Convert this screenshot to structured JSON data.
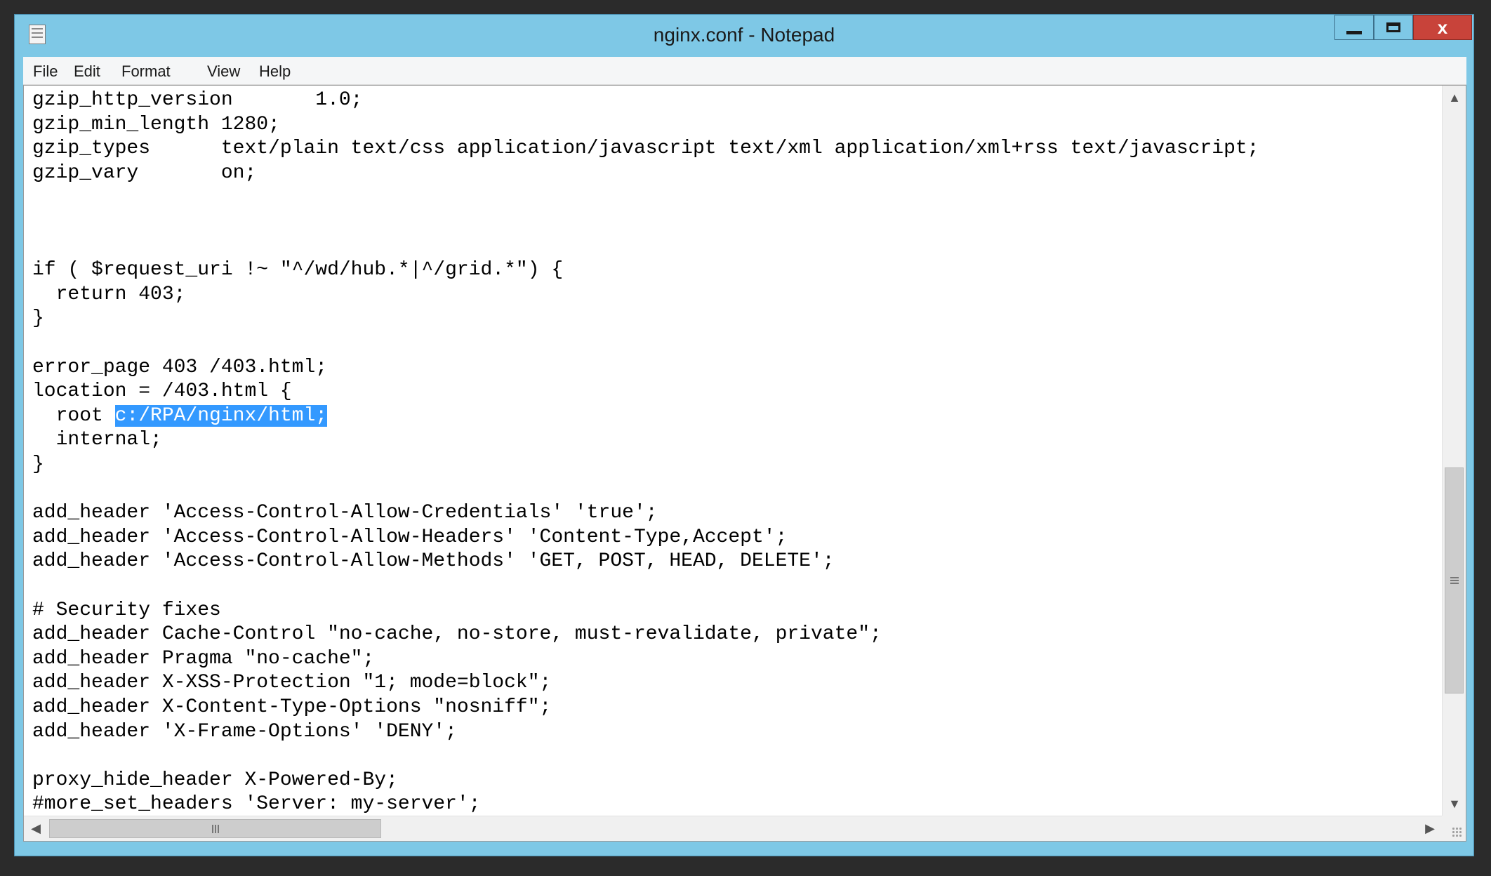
{
  "window": {
    "title": "nginx.conf - Notepad",
    "close_label": "x"
  },
  "menu": [
    "File",
    "Edit",
    "Format",
    "View",
    "Help"
  ],
  "editor": {
    "lines": [
      "gzip_http_version       1.0;",
      "gzip_min_length 1280;",
      "gzip_types      text/plain text/css application/javascript text/xml application/xml+rss text/javascript;",
      "gzip_vary       on;",
      "",
      "",
      "",
      "if ( $request_uri !~ \"^/wd/hub.*|^/grid.*\") {",
      "  return 403;",
      "}",
      "",
      "error_page 403 /403.html;",
      "location = /403.html {",
      "  root ",
      "  internal;",
      "}",
      "",
      "add_header 'Access-Control-Allow-Credentials' 'true';",
      "add_header 'Access-Control-Allow-Headers' 'Content-Type,Accept';",
      "add_header 'Access-Control-Allow-Methods' 'GET, POST, HEAD, DELETE';",
      "",
      "# Security fixes",
      "add_header Cache-Control \"no-cache, no-store, must-revalidate, private\";",
      "add_header Pragma \"no-cache\";",
      "add_header X-XSS-Protection \"1; mode=block\";",
      "add_header X-Content-Type-Options \"nosniff\";",
      "add_header 'X-Frame-Options' 'DENY';",
      "",
      "proxy_hide_header X-Powered-By;",
      "#more_set_headers 'Server: my-server';"
    ],
    "selection": {
      "line": 13,
      "text": "c:/RPA/nginx/html;"
    }
  },
  "scrollbars": {
    "vertical_position": 0.55,
    "horizontal_position": 0.0
  },
  "colors": {
    "titlebar": "#7ec8e6",
    "selection": "#3399ff",
    "close_button": "#c8433a"
  }
}
